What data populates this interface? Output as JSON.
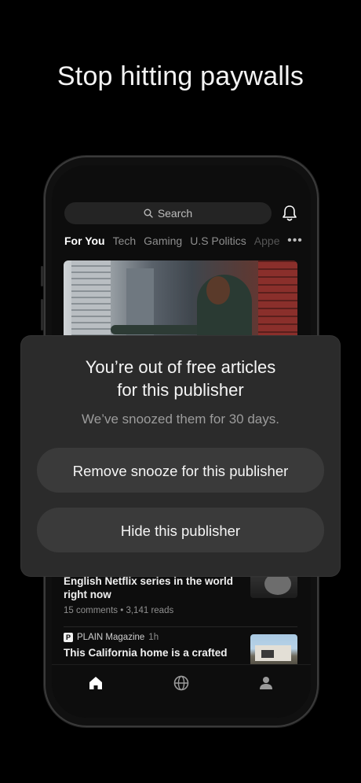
{
  "headline": "Stop hitting paywalls",
  "search": {
    "label": "Search"
  },
  "tabs": [
    "For You",
    "Tech",
    "Gaming",
    "U.S Politics",
    "Appe"
  ],
  "articles": [
    {
      "title": "English Netflix series in the world right now",
      "comments": "15 comments",
      "separator": "•",
      "reads": "3,141 reads"
    },
    {
      "publisher": "PLAIN Magazine",
      "publisher_logo": "P",
      "time": "1h",
      "title": "This California home is a crafted"
    }
  ],
  "modal": {
    "title": "You’re out of free articles\nfor this publisher",
    "subtitle": "We’ve snoozed them for 30 days.",
    "primary_button": "Remove snooze for this publisher",
    "secondary_button": "Hide this publisher"
  },
  "icons": {
    "search": "search-icon",
    "bell": "bell-icon",
    "more": "more-dots-icon",
    "home": "home-icon",
    "globe": "globe-icon",
    "profile": "profile-icon"
  },
  "colors": {
    "background": "#000000",
    "modal": "#2b2b2b",
    "button": "#3a3a3a",
    "search": "#242424"
  }
}
